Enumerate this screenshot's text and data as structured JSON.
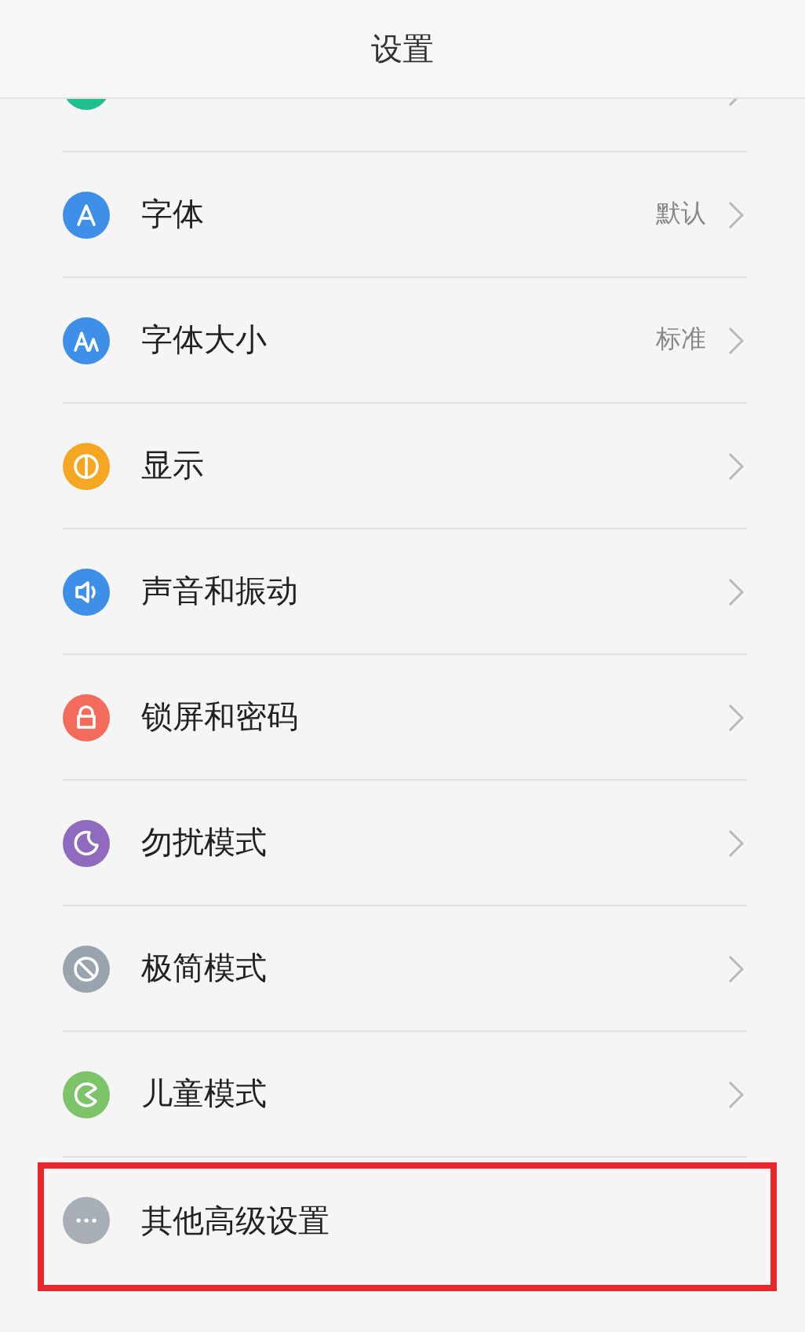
{
  "header": {
    "title": "设置"
  },
  "items": [
    {
      "color": "#1fbf8f",
      "chevron": true,
      "highlighted": false
    },
    {
      "label": "字体",
      "value": "默认",
      "color": "#3d8fe8",
      "chevron": true,
      "highlighted": false
    },
    {
      "label": "字体大小",
      "value": "标准",
      "color": "#3d8fe8",
      "chevron": true,
      "highlighted": false
    },
    {
      "label": "显示",
      "color": "#f5a623",
      "chevron": true,
      "highlighted": false
    },
    {
      "label": "声音和振动",
      "color": "#3d8fe8",
      "chevron": true,
      "highlighted": false
    },
    {
      "label": "锁屏和密码",
      "color": "#f26b5b",
      "chevron": true,
      "highlighted": false
    },
    {
      "label": "勿扰模式",
      "color": "#8e6bbf",
      "chevron": true,
      "highlighted": false
    },
    {
      "label": "极简模式",
      "color": "#9aa4ae",
      "chevron": true,
      "highlighted": false
    },
    {
      "label": "儿童模式",
      "color": "#7cc36a",
      "chevron": true,
      "highlighted": false
    },
    {
      "label": "其他高级设置",
      "color": "#a7aeb6",
      "chevron": false,
      "highlighted": true
    }
  ]
}
